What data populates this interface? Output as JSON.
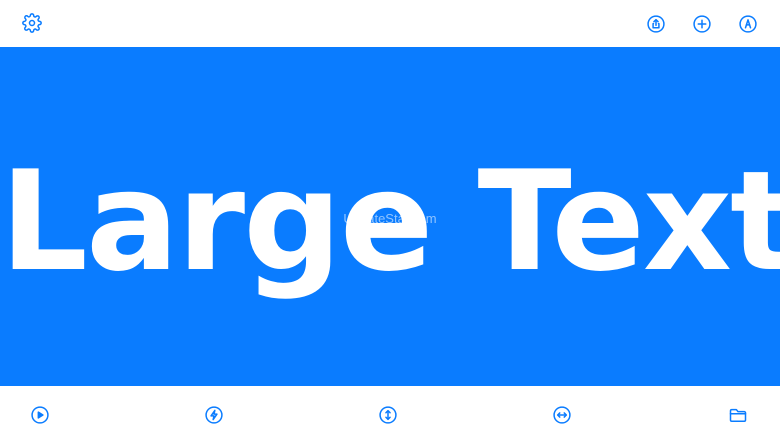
{
  "toolbar": {
    "top_left": [
      {
        "name": "settings",
        "icon": "gear-icon"
      }
    ],
    "top_right": [
      {
        "name": "share",
        "icon": "share-icon"
      },
      {
        "name": "add",
        "icon": "plus-icon"
      },
      {
        "name": "markup",
        "icon": "pen-icon"
      }
    ],
    "bottom": [
      {
        "name": "play",
        "icon": "play-icon"
      },
      {
        "name": "flash",
        "icon": "lightning-icon"
      },
      {
        "name": "vertical-resize",
        "icon": "vertical-arrows-icon"
      },
      {
        "name": "horizontal-resize",
        "icon": "horizontal-arrows-icon"
      },
      {
        "name": "files",
        "icon": "folder-icon"
      }
    ]
  },
  "display": {
    "text": "Large Text",
    "background_color": "#0a7cff",
    "text_color": "#ffffff"
  },
  "watermark": {
    "text": "UpdateStar.com"
  },
  "colors": {
    "accent": "#0a7cff",
    "bar_background": "#ffffff"
  }
}
